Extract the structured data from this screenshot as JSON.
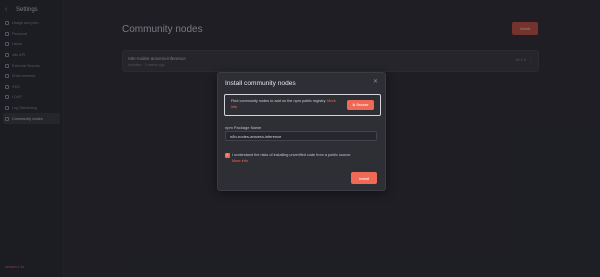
{
  "sidebar": {
    "back_icon": "chevron-left-icon",
    "title": "Settings",
    "items": [
      {
        "label": "Usage and plan",
        "icon": "chart-icon",
        "active": false
      },
      {
        "label": "Personal",
        "icon": "user-icon",
        "active": false
      },
      {
        "label": "Users",
        "icon": "users-icon",
        "active": false
      },
      {
        "label": "n8n API",
        "icon": "plug-icon",
        "active": false
      },
      {
        "label": "External Secrets",
        "icon": "lock-icon",
        "active": false
      },
      {
        "label": "Environments",
        "icon": "branch-icon",
        "active": false
      },
      {
        "label": "SSO",
        "icon": "key-icon",
        "active": false
      },
      {
        "label": "LDAP",
        "icon": "network-icon",
        "active": false
      },
      {
        "label": "Log Streaming",
        "icon": "stream-icon",
        "active": false
      },
      {
        "label": "Community nodes",
        "icon": "cube-icon",
        "active": true
      }
    ],
    "version": "version 1.xx"
  },
  "main": {
    "title": "Community nodes",
    "install_button": "Install",
    "node_card": {
      "name": "n8n-nodes-amvera-inference",
      "subtitle": "Installed · 3 weeks ago",
      "version": "v0.1.0",
      "menu_icon": "dots-vertical-icon"
    }
  },
  "modal": {
    "title": "Install community nodes",
    "close_icon": "close-icon",
    "info_text": "Find community nodes to add on the npm public registry.",
    "info_link": "More info",
    "browse_label": "Browse",
    "browse_icon": "external-link-icon",
    "package_label": "npm Package Name",
    "package_value": "n8n-nodes-amvera-inference",
    "consent_text": "I understand the risks of installing unverified code from a public source.",
    "consent_link": "More info",
    "consent_checked": true,
    "install_label": "Install"
  },
  "colors": {
    "accent": "#ee6a56",
    "background": "#2d2e35",
    "modal_bg": "#2e2f35"
  }
}
